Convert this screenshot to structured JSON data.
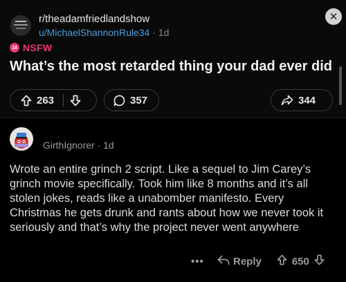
{
  "post": {
    "subreddit": "r/theadamfriedlandshow",
    "author": "u/MichaelShannonRule34",
    "time": " · 1d",
    "nsfw_badge": "18",
    "nsfw_label": "NSFW",
    "title": "What’s the most retarded thing your dad ever did",
    "upvotes": "263",
    "comments": "357",
    "shares": "344"
  },
  "comment": {
    "author": "GirthIgnorer",
    "time": " · 1d",
    "body": "Wrote an entire grinch 2 script. Like a sequel to Jim Carey’s grinch movie specifically. Took him like 8 months and it’s all stolen jokes, reads like a unabomber manifesto. Every Christmas he gets drunk and rants about how we never took it seriously and that’s why the project never went anywhere",
    "more": "•••",
    "reply_label": "Reply",
    "votes": "650"
  },
  "icons": {
    "close": "close-icon",
    "upvote": "arrow-up-icon",
    "downvote": "arrow-down-icon",
    "comments": "speech-bubble-icon",
    "share": "share-arrow-icon",
    "reply": "reply-arrow-icon"
  },
  "colors": {
    "accent_link": "#4a9fe0",
    "nsfw": "#e8367a"
  }
}
